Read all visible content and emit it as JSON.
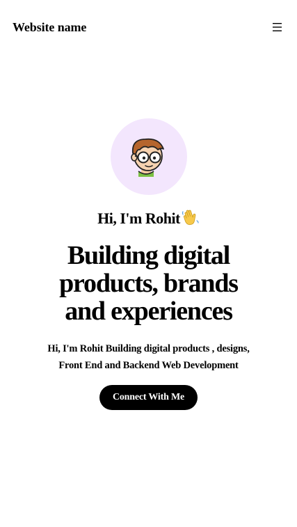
{
  "navbar": {
    "brand": "Website name",
    "menu_icon": "hamburger-menu-icon"
  },
  "hero": {
    "avatar_icon": "cartoon-avatar-with-glasses",
    "greeting": "Hi, I'm Rohit",
    "greeting_icon": "waving-hand-icon",
    "headline": "Building digital products, brands and experiences",
    "subtitle": "Hi, I'm Rohit Building digital products , designs, Front End and Backend Web Development",
    "cta_label": "Connect With Me"
  },
  "colors": {
    "background": "#ffffff",
    "text": "#000000",
    "avatar_bg": "#f3e6fd",
    "button_bg": "#000000",
    "button_text": "#ffffff"
  }
}
